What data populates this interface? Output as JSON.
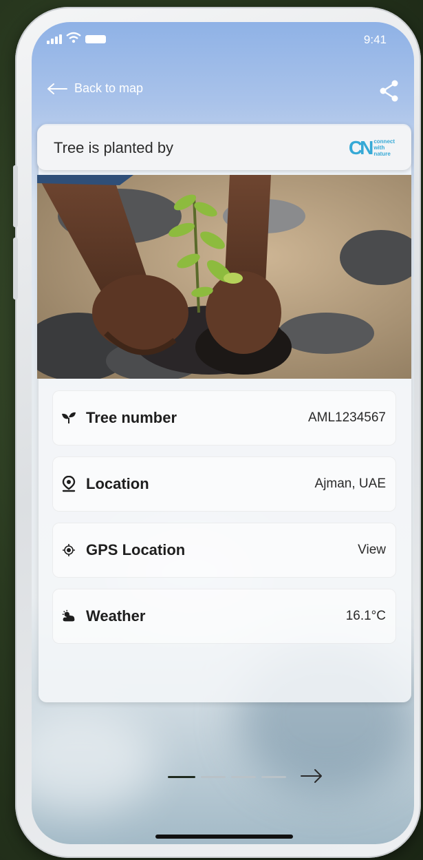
{
  "status_bar": {
    "time": "9:41"
  },
  "header": {
    "back_label": "Back to map"
  },
  "planted_by": {
    "label": "Tree is planted by",
    "logo_mark": "CN",
    "logo_words": [
      "connect",
      "with",
      "nature"
    ],
    "logo_color": "#36a9d6"
  },
  "details": [
    {
      "icon": "seedling-icon",
      "title": "Tree number",
      "value": "AML1234567"
    },
    {
      "icon": "location-pin-icon",
      "title": "Location",
      "value": "Ajman, UAE"
    },
    {
      "icon": "gps-target-icon",
      "title": "GPS Location",
      "value": "View"
    },
    {
      "icon": "weather-cloud-sun-icon",
      "title": "Weather",
      "value": "16.1°C"
    }
  ],
  "pager": {
    "count": 4,
    "active_index": 0
  },
  "colors": {
    "accent": "#36a9d6",
    "pager_active": "#1f2a1e"
  }
}
